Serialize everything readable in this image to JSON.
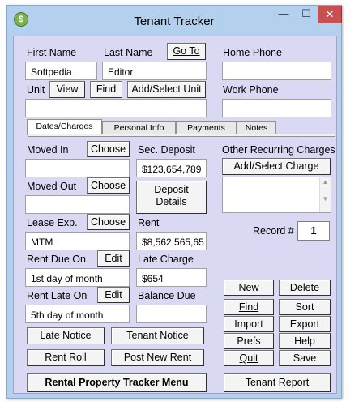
{
  "window": {
    "title": "Tenant Tracker",
    "min": "—",
    "max": "☐",
    "close": "✕"
  },
  "tenant": {
    "first_name_label": "First Name",
    "first_name": "Softpedia",
    "last_name_label": "Last Name",
    "last_name": "Editor",
    "goto_label": "Go To",
    "home_phone_label": "Home Phone",
    "home_phone": "",
    "work_phone_label": "Work Phone",
    "work_phone": "",
    "unit_label": "Unit",
    "view_label": "View",
    "find_label": "Find",
    "add_select_unit_label": "Add/Select Unit",
    "unit": ""
  },
  "tabs": [
    "Dates/Charges",
    "Personal Info",
    "Payments",
    "Notes"
  ],
  "dates": {
    "moved_in_label": "Moved In",
    "moved_in": "",
    "moved_out_label": "Moved Out",
    "moved_out": "",
    "lease_exp_label": "Lease Exp.",
    "lease_exp": "MTM",
    "choose_label": "Choose",
    "rent_due_label": "Rent Due On",
    "rent_due": "1st day of month",
    "rent_late_label": "Rent Late On",
    "rent_late": "5th day of month",
    "edit_label": "Edit"
  },
  "charges": {
    "sec_deposit_label": "Sec. Deposit",
    "sec_deposit": "$123,654,789",
    "deposit_details_line1": "Deposit",
    "deposit_details_line2": "Details",
    "rent_label": "Rent",
    "rent": "$8,562,565,65",
    "late_charge_label": "Late Charge",
    "late_charge": "$654",
    "balance_due_label": "Balance Due",
    "balance_due": ""
  },
  "other": {
    "label": "Other Recurring Charges",
    "add_select_charge": "Add/Select Charge"
  },
  "record": {
    "label": "Record #",
    "value": "1"
  },
  "actions": {
    "new": "New",
    "delete": "Delete",
    "find": "Find",
    "sort": "Sort",
    "import": "Import",
    "export": "Export",
    "prefs": "Prefs",
    "help": "Help",
    "quit": "Quit",
    "save": "Save"
  },
  "bottom": {
    "late_notice": "Late Notice",
    "tenant_notice": "Tenant Notice",
    "rent_roll": "Rent Roll",
    "post_new_rent": "Post New Rent",
    "menu": "Rental Property Tracker Menu",
    "tenant_report": "Tenant Report"
  }
}
